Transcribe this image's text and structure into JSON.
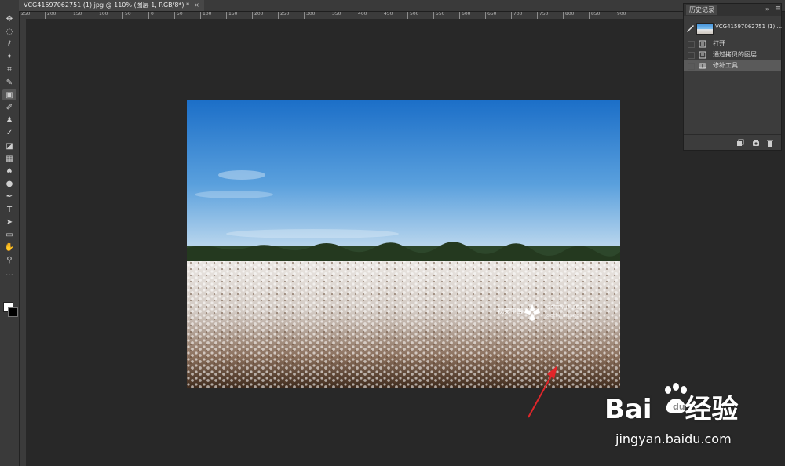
{
  "document_tab": {
    "title": "VCG41597062751 (1).jpg @ 110% (图层 1, RGB/8*) *",
    "close": "×"
  },
  "ruler": {
    "labels": [
      "250",
      "200",
      "150",
      "100",
      "50",
      "0",
      "50",
      "100",
      "150",
      "200",
      "250",
      "300",
      "350",
      "400",
      "450",
      "500",
      "550",
      "600",
      "650",
      "700",
      "750",
      "800",
      "850",
      "900"
    ]
  },
  "toolbar": {
    "tools": [
      "move",
      "marquee",
      "lasso",
      "quick-select",
      "crop",
      "eyedropper",
      "patch",
      "brush",
      "stamp",
      "history-brush",
      "eraser",
      "gradient",
      "blur",
      "dodge",
      "pen",
      "type",
      "path-select",
      "shape",
      "hand",
      "zoom",
      "more"
    ],
    "active_tool": "patch",
    "foreground_color": "#ffffff",
    "background_color": "#000000"
  },
  "history_panel": {
    "title": "历史记录",
    "collapse": "»",
    "menu": "≡",
    "snapshot_label": "VCG41597062751 (1)....",
    "items": [
      {
        "label": "打开",
        "icon": "document-icon"
      },
      {
        "label": "通过拷贝的图层",
        "icon": "document-icon"
      },
      {
        "label": "修补工具",
        "icon": "patch-icon",
        "active": true
      }
    ]
  },
  "photo": {
    "sky_top": "#1f72c9",
    "sky_bottom": "#c9dff0",
    "trees": "#2e4a2a",
    "field": "#f2eeea",
    "watermark_cn": "视觉中国",
    "watermark_en": [
      "GETTY IMAGES",
      "getty images"
    ]
  },
  "watermark": {
    "logo": "Bai",
    "logo_suffix": "经验",
    "url": "jingyan.baidu.com"
  },
  "annotation": {
    "color": "#e0262a"
  }
}
